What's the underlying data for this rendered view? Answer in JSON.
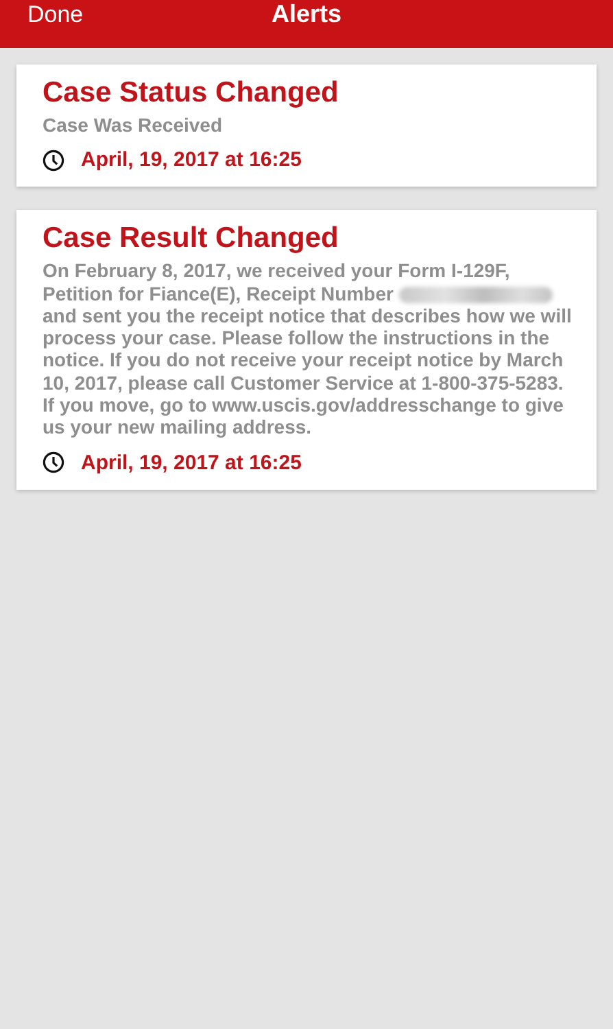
{
  "header": {
    "left_button": "Done",
    "title": "Alerts"
  },
  "alerts": [
    {
      "title": "Case Status Changed",
      "body_before": "Case Was Received",
      "redacted": false,
      "time": "April, 19, 2017 at 16:25"
    },
    {
      "title": "Case Result Changed",
      "body_before": "On February 8, 2017, we received your Form I-129F, Petition for Fiance(E), Receipt Number",
      "redacted": true,
      "body_after": "and sent you the receipt notice that describes how we will process your case. Please follow the instructions in the notice. If you do not receive your receipt notice by March 10, 2017, please call Customer Service at 1-800-375-5283. If you move, go to www.uscis.gov/addresschange to give us your new mailing address.",
      "time": "April, 19, 2017 at 16:25"
    }
  ]
}
